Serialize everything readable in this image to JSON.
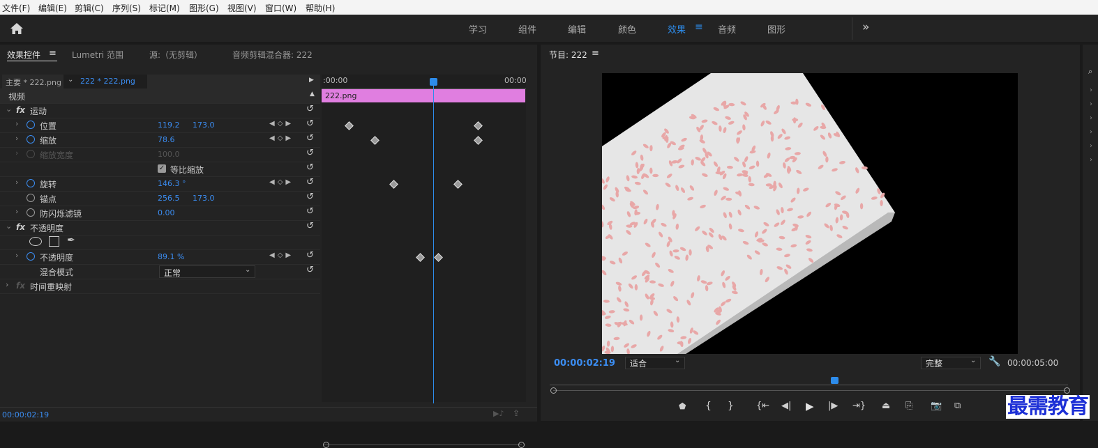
{
  "menu": [
    "文件(F)",
    "编辑(E)",
    "剪辑(C)",
    "序列(S)",
    "标记(M)",
    "图形(G)",
    "视图(V)",
    "窗口(W)",
    "帮助(H)"
  ],
  "workspaces": {
    "items": [
      "学习",
      "组件",
      "编辑",
      "颜色",
      "效果",
      "音频",
      "图形"
    ],
    "active": "效果",
    "overflow": "»"
  },
  "left_tabs": {
    "effect_controls": "效果控件",
    "lumetri": "Lumetri 范围",
    "source": "源:（无剪辑）",
    "audio_mixer": "音频剪辑混合器: 222"
  },
  "clip_header": {
    "master": "主要 * 222.png",
    "clip": "222 * 222.png"
  },
  "timeline": {
    "start_time": ":00:00",
    "end_time": "00:00",
    "clip_name": "222.png",
    "clip_color": "#e07ee0"
  },
  "effects": {
    "video_label": "视频",
    "motion": {
      "name": "运动",
      "position": {
        "label": "位置",
        "x": "119.2",
        "y": "173.0"
      },
      "scale": {
        "label": "缩放",
        "value": "78.6"
      },
      "scale_width": {
        "label": "缩放宽度",
        "value": "100.0"
      },
      "uniform_scale": {
        "label": "等比缩放",
        "checked": true
      },
      "rotation": {
        "label": "旋转",
        "value": "146.3 °"
      },
      "anchor": {
        "label": "锚点",
        "x": "256.5",
        "y": "173.0"
      },
      "antiflicker": {
        "label": "防闪烁滤镜",
        "value": "0.00"
      }
    },
    "opacity": {
      "name": "不透明度",
      "opacity": {
        "label": "不透明度",
        "value": "89.1 %"
      },
      "blend": {
        "label": "混合模式",
        "value": "正常"
      }
    },
    "time_remap": {
      "name": "时间重映射"
    }
  },
  "footer_time": "00:00:02:19",
  "program": {
    "title": "节目: 222",
    "timecode": "00:00:02:19",
    "fit": "适合",
    "quality": "完整",
    "duration": "00:00:05:00"
  },
  "watermark": "最需教育",
  "colors": {
    "accent": "#2d8ceb",
    "clip": "#e07ee0",
    "bg": "#232323"
  }
}
